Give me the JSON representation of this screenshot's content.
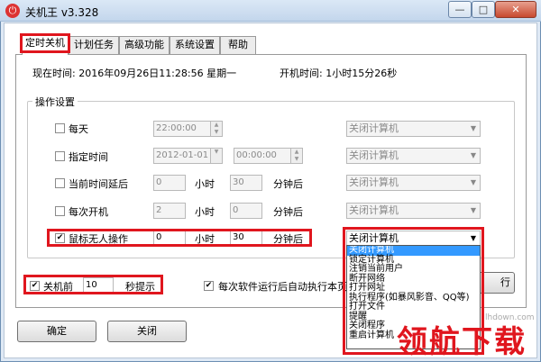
{
  "window": {
    "title": "关机王 v3.328",
    "min_label": "—",
    "max_label": "□",
    "close_label": "✕"
  },
  "tabs": [
    {
      "label": "定时关机"
    },
    {
      "label": "计划任务"
    },
    {
      "label": "高级功能"
    },
    {
      "label": "系统设置"
    },
    {
      "label": "帮助"
    }
  ],
  "info": {
    "current_time": "现在时间: 2016年09月26日11:28:56 星期一",
    "uptime": "开机时间: 1小时15分26秒"
  },
  "group_title": "操作设置",
  "rows": {
    "daily": {
      "label": "每天",
      "time": "22:00:00",
      "action": "关闭计算机"
    },
    "specified": {
      "label": "指定时间",
      "date": "2012-01-01",
      "time": "00:00:00",
      "action": "关闭计算机"
    },
    "delay": {
      "label": "当前时间延后",
      "hours": "0",
      "hours_unit": "小时",
      "minutes": "30",
      "minutes_unit": "分钟后",
      "action": "关闭计算机"
    },
    "each_boot": {
      "label": "每次开机",
      "hours": "2",
      "hours_unit": "小时",
      "minutes": "0",
      "minutes_unit": "分钟后",
      "action": "关闭计算机"
    },
    "idle": {
      "label": "鼠标无人操作",
      "hours": "0",
      "hours_unit": "小时",
      "minutes": "30",
      "minutes_unit": "分钟后",
      "action": "关闭计算机"
    }
  },
  "dropdown_options": [
    "关闭计算机",
    "锁定计算机",
    "注销当前用户",
    "断开网络",
    "打开网址",
    "执行程序(如暴风影音、QQ等)",
    "打开文件",
    "提醒",
    "关闭程序",
    "重启计算机"
  ],
  "remind": {
    "label": "关机前",
    "seconds": "10",
    "suffix": "秒提示"
  },
  "auto_exec": {
    "label": "每次软件运行后自动执行本页",
    "button_tail": "行"
  },
  "buttons": {
    "ok": "确定",
    "close": "关闭"
  },
  "watermark": {
    "text": "领航下载",
    "url": "lhdown.com"
  },
  "colors": {
    "highlight_border": "#e0161e",
    "selection": "#3399ff"
  }
}
